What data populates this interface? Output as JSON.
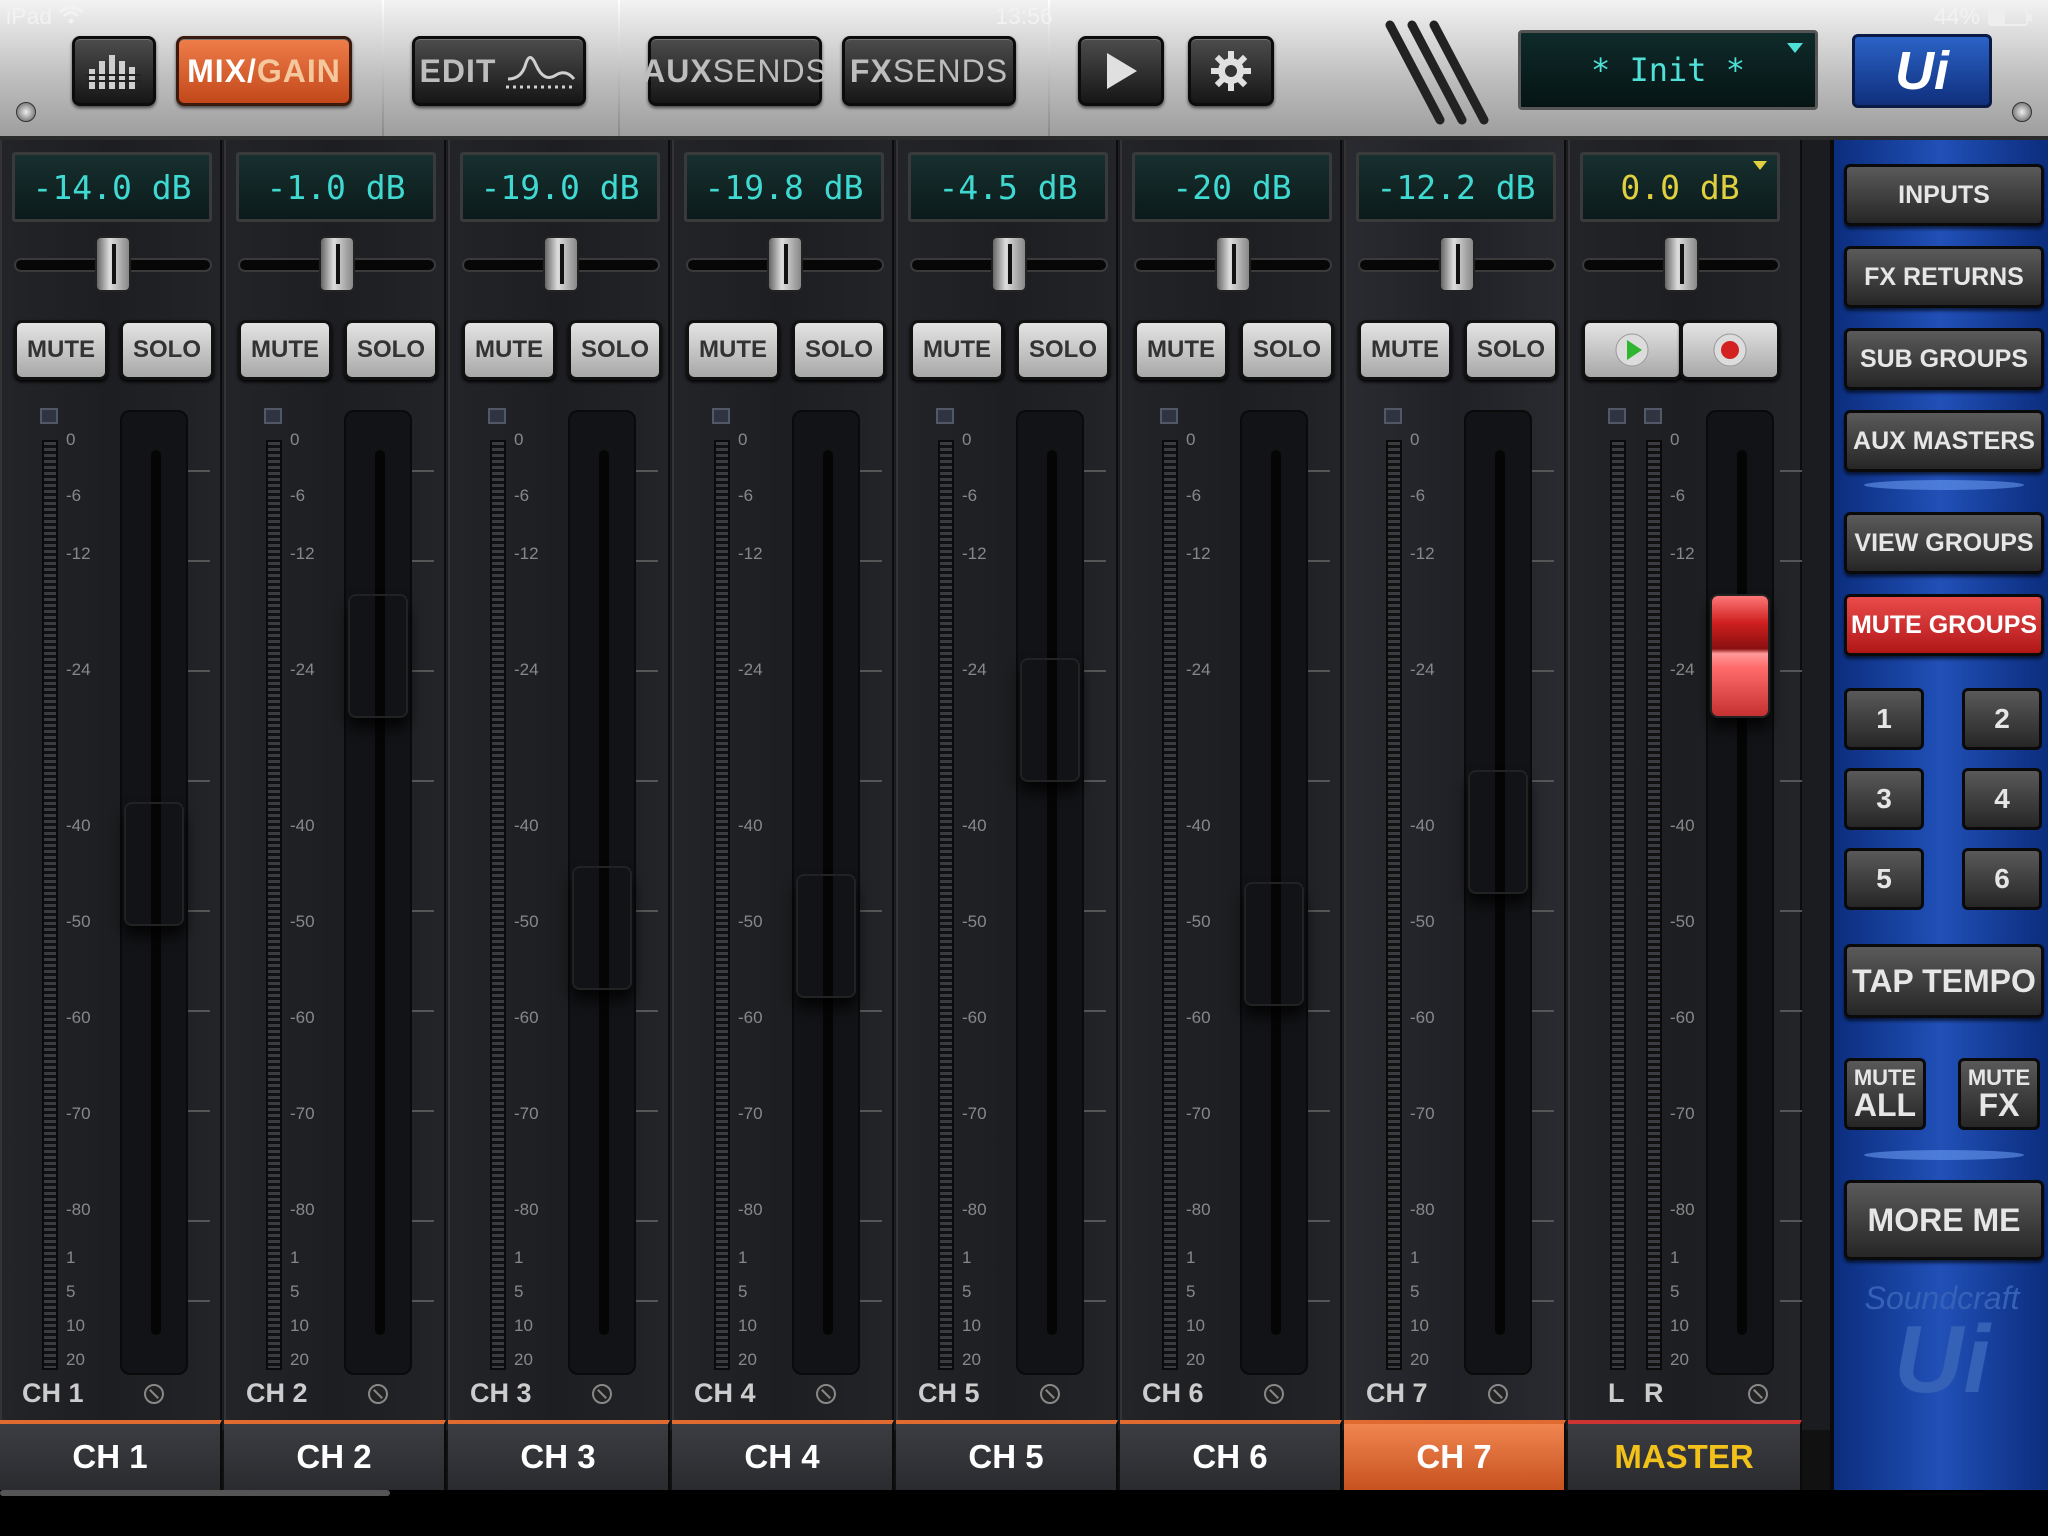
{
  "status_bar": {
    "device": "iPad",
    "time": "13:56",
    "battery": "44%"
  },
  "toolbar": {
    "mix_gain_a": "MIX",
    "mix_gain_sep": "/",
    "mix_gain_b": "GAIN",
    "edit_label": "EDIT",
    "aux_a": "AUX",
    "aux_b": "SENDS",
    "fx_a": "FX",
    "fx_b": "SENDS",
    "scene": "* Init *",
    "logo": "Ui"
  },
  "meter_scale": [
    "0",
    "-6",
    "-12",
    "-24",
    "-40",
    "-50",
    "-60",
    "-70",
    "-80",
    "1",
    "5",
    "10",
    "20"
  ],
  "strips": [
    {
      "tag": "CH 1",
      "db": "-14.0 dB",
      "tab": "CH 1",
      "fader": 0.52,
      "pan": 0.5
    },
    {
      "tag": "CH 2",
      "db": "-1.0 dB",
      "tab": "CH 2",
      "fader": 0.78,
      "pan": 0.5
    },
    {
      "tag": "CH 3",
      "db": "-19.0 dB",
      "tab": "CH 3",
      "fader": 0.44,
      "pan": 0.5
    },
    {
      "tag": "CH 4",
      "db": "-19.8 dB",
      "tab": "CH 4",
      "fader": 0.43,
      "pan": 0.5
    },
    {
      "tag": "CH 5",
      "db": "-4.5 dB",
      "tab": "CH 5",
      "fader": 0.7,
      "pan": 0.5
    },
    {
      "tag": "CH 6",
      "db": "-20 dB",
      "tab": "CH 6",
      "fader": 0.42,
      "pan": 0.5
    },
    {
      "tag": "CH 7",
      "db": "-12.2 dB",
      "tab": "CH 7",
      "fader": 0.56,
      "pan": 0.5
    }
  ],
  "buttons": {
    "mute": "MUTE",
    "solo": "SOLO"
  },
  "master": {
    "db": "0.0 dB",
    "tab": "MASTER",
    "left": "L",
    "right": "R",
    "fader": 0.78,
    "pan": 0.5
  },
  "right_panel": {
    "inputs": "INPUTS",
    "fx_returns": "FX RETURNS",
    "sub_groups": "SUB GROUPS",
    "aux_masters": "AUX MASTERS",
    "view_groups": "VIEW GROUPS",
    "mute_groups": "MUTE GROUPS",
    "groups": [
      "1",
      "2",
      "3",
      "4",
      "5",
      "6"
    ],
    "tap_tempo": "TAP TEMPO",
    "mute_all_a": "MUTE",
    "mute_all_b": "ALL",
    "mute_fx_a": "MUTE",
    "mute_fx_b": "FX",
    "more_me": "MORE ME",
    "brand_a": "Soundcraft",
    "brand_b": "Ui"
  },
  "colors": {
    "accent": "#e06a2f",
    "lcd": "#3fd9d2",
    "master": "#f2c11a",
    "panel": "#2150b7"
  }
}
